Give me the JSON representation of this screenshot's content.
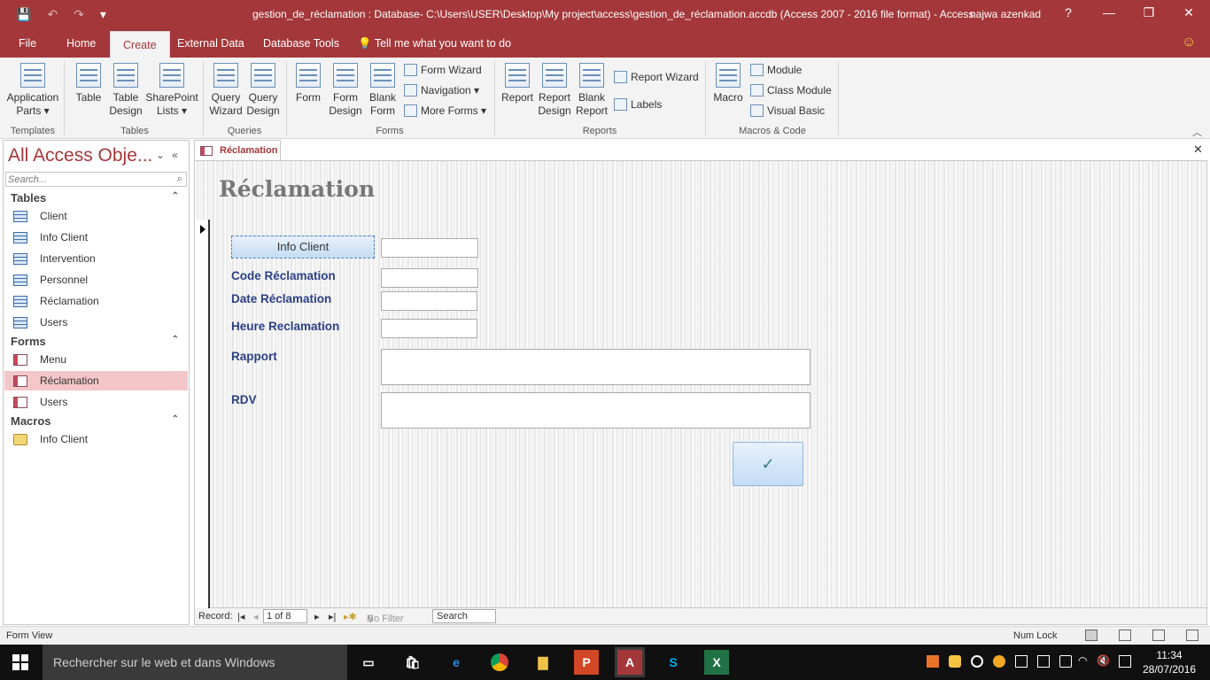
{
  "titlebar": {
    "title": "gestion_de_réclamation : Database- C:\\Users\\USER\\Desktop\\My project\\access\\gestion_de_réclamation.accdb (Access 2007 - 2016 file format) - Access",
    "user": "najwa azenkad",
    "help": "?",
    "qat": {
      "save": "💾",
      "undo": "↶",
      "redo": "↷",
      "customize": "▾"
    },
    "window_buttons": {
      "minimize": "—",
      "restore": "❐",
      "close": "✕"
    }
  },
  "tabs": [
    "File",
    "Home",
    "Create",
    "External Data",
    "Database Tools"
  ],
  "tell_me": "Tell me what you want to do",
  "ribbon": {
    "templates": {
      "app_parts": "Application",
      "app_parts2": "Parts ▾",
      "label": "Templates"
    },
    "tables": {
      "table": "Table",
      "table_design": "Table",
      "table_design2": "Design",
      "sharepoint": "SharePoint",
      "sharepoint2": "Lists ▾",
      "label": "Tables"
    },
    "queries": {
      "wizard": "Query",
      "wizard2": "Wizard",
      "design": "Query",
      "design2": "Design",
      "label": "Queries"
    },
    "forms": {
      "form": "Form",
      "form_design": "Form",
      "form_design2": "Design",
      "blank": "Blank",
      "blank2": "Form",
      "wizard": "Form Wizard",
      "navigation": "Navigation ▾",
      "more": "More Forms ▾",
      "label": "Forms"
    },
    "reports": {
      "report": "Report",
      "report_design": "Report",
      "report_design2": "Design",
      "blank": "Blank",
      "blank2": "Report",
      "wizard": "Report Wizard",
      "labels": "Labels",
      "label": "Reports"
    },
    "macros": {
      "macro": "Macro",
      "module": "Module",
      "class_module": "Class Module",
      "vb": "Visual Basic",
      "label": "Macros & Code"
    }
  },
  "nav": {
    "title": "All Access Obje...",
    "search_placeholder": "Search...",
    "groups": {
      "tables": {
        "label": "Tables",
        "items": [
          "Client",
          "Info Client",
          "Intervention",
          "Personnel",
          "Réclamation",
          "Users"
        ]
      },
      "forms": {
        "label": "Forms",
        "items": [
          "Menu",
          "Réclamation",
          "Users"
        ]
      },
      "macros": {
        "label": "Macros",
        "items": [
          "Info Client"
        ]
      }
    }
  },
  "document": {
    "tab_label": "Réclamation",
    "form_title": "Réclamation",
    "button_info_client": "Info Client",
    "labels": {
      "code": "Code Réclamation",
      "date": "Date Réclamation",
      "heure": "Heure Reclamation",
      "rapport": "Rapport",
      "rdv": "RDV"
    },
    "ok_glyph": "✓"
  },
  "record_nav": {
    "label": "Record:",
    "position": "1 of 8",
    "filter": "No Filter",
    "search": "Search"
  },
  "status": {
    "view": "Form View",
    "numlock": "Num Lock"
  },
  "taskbar": {
    "search": "Rechercher sur le web et dans Windows",
    "time": "11:34",
    "date": "28/07/2016"
  }
}
